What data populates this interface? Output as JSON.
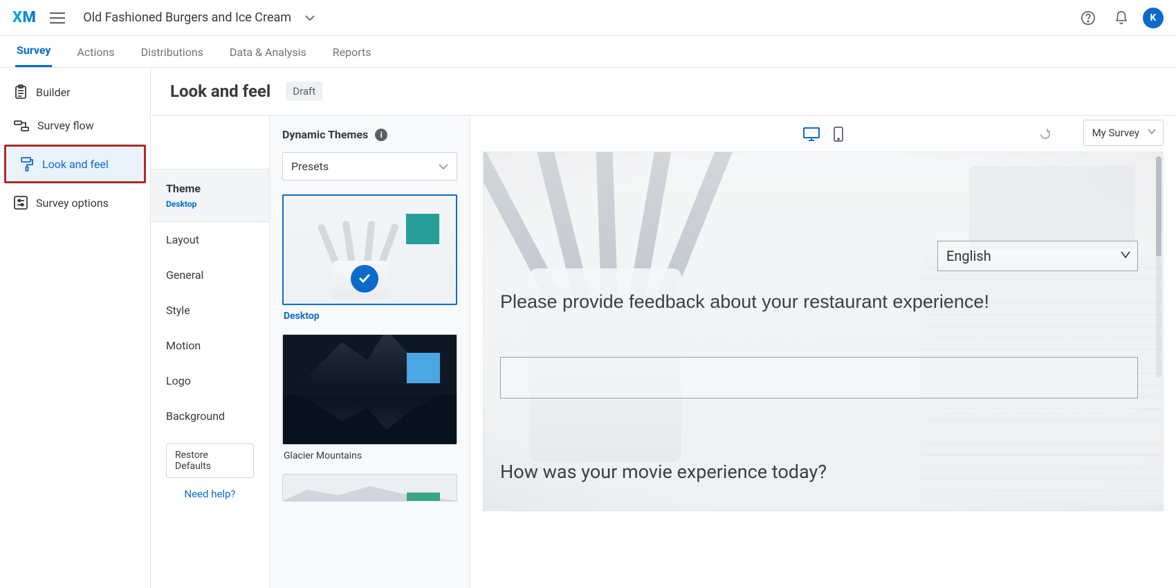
{
  "header": {
    "logo": "XM",
    "project_name": "Old Fashioned Burgers and Ice Cream",
    "avatar_letter": "K"
  },
  "top_tabs": [
    {
      "label": "Survey",
      "active": true
    },
    {
      "label": "Actions"
    },
    {
      "label": "Distributions"
    },
    {
      "label": "Data & Analysis"
    },
    {
      "label": "Reports"
    }
  ],
  "left_nav": [
    {
      "id": "builder",
      "label": "Builder"
    },
    {
      "id": "survey-flow",
      "label": "Survey flow"
    },
    {
      "id": "look-and-feel",
      "label": "Look and feel",
      "active": true
    },
    {
      "id": "survey-options",
      "label": "Survey options"
    }
  ],
  "page": {
    "title": "Look and feel",
    "status": "Draft"
  },
  "settings_col": {
    "theme_block": {
      "label": "Theme",
      "sub": "Desktop"
    },
    "rows": [
      {
        "id": "layout",
        "label": "Layout"
      },
      {
        "id": "general",
        "label": "General"
      },
      {
        "id": "style",
        "label": "Style"
      },
      {
        "id": "motion",
        "label": "Motion"
      },
      {
        "id": "logo",
        "label": "Logo"
      },
      {
        "id": "background",
        "label": "Background"
      }
    ],
    "restore": "Restore Defaults",
    "need_help": "Need help?"
  },
  "themes_col": {
    "title": "Dynamic Themes",
    "dropdown": "Presets",
    "themes": [
      {
        "id": "desktop",
        "name": "Desktop",
        "selected": true,
        "swatch": "#279f98"
      },
      {
        "id": "glacier",
        "name": "Glacier Mountains",
        "swatch": "#4aa7e3"
      },
      {
        "id": "third",
        "name": "",
        "swatch": "#3aa482"
      }
    ]
  },
  "preview": {
    "survey_dropdown": "My Survey",
    "language": "English",
    "question1": "Please provide feedback about your restaurant experience!",
    "question2": "How was your movie experience today?"
  }
}
